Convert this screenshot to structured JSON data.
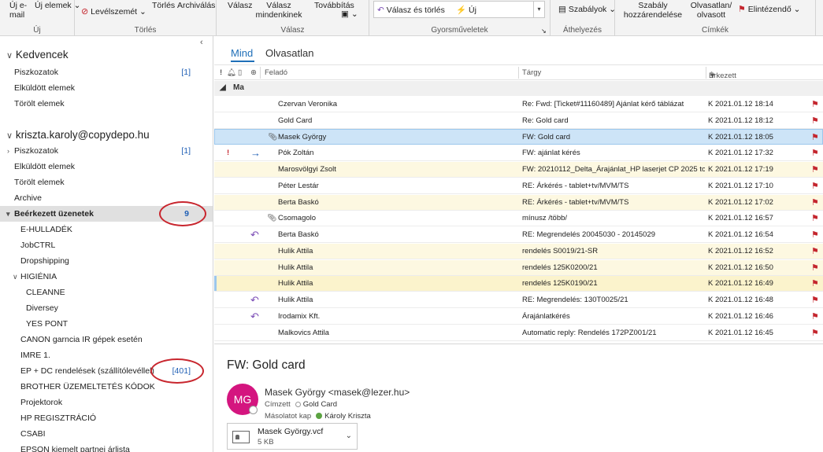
{
  "ribbon": {
    "groups": [
      {
        "caption": "Új"
      },
      {
        "caption": "Törlés"
      },
      {
        "caption": "Válasz"
      },
      {
        "caption": "Gyorsműveletek"
      },
      {
        "caption": "Áthelyezés"
      },
      {
        "caption": "Címkék"
      }
    ],
    "new_email": "Új e-mail",
    "new_items": "Új elemek",
    "junk": "Levélszemét",
    "delete": "Törlés",
    "archive": "Archiválás",
    "reply": "Válasz",
    "reply_all": "Válasz mindenkinek",
    "forward": "Továbbítás",
    "quick_reply_delete": "Válasz és törlés",
    "quick_new": "Új",
    "rules": "Szabályok",
    "assign_policy": "Szabály hozzárendelése",
    "unread_read": "Olvasatlan/ olvasott",
    "followup": "Elintézendő"
  },
  "folders": {
    "favorites_title": "Kedvencek",
    "favorites": [
      {
        "label": "Piszkozatok",
        "count": "[1]"
      },
      {
        "label": "Elküldött elemek",
        "count": ""
      },
      {
        "label": "Törölt elemek",
        "count": ""
      }
    ],
    "account": "kriszta.karoly@copydepo.hu",
    "items": [
      {
        "label": "Piszkozatok",
        "count": "[1]"
      },
      {
        "label": "Elküldött elemek",
        "count": ""
      },
      {
        "label": "Törölt elemek",
        "count": ""
      },
      {
        "label": "Archive",
        "count": ""
      },
      {
        "label": "Beérkezett üzenetek",
        "count": "9"
      },
      {
        "label": "E-HULLADÉK",
        "count": ""
      },
      {
        "label": "JobCTRL",
        "count": ""
      },
      {
        "label": "Dropshipping",
        "count": ""
      },
      {
        "label": "HIGIÉNIA",
        "count": ""
      },
      {
        "label": "CLEANNE",
        "count": ""
      },
      {
        "label": "Diversey",
        "count": ""
      },
      {
        "label": "YES PONT",
        "count": ""
      },
      {
        "label": "CANON garncia IR gépek esetén",
        "count": ""
      },
      {
        "label": "IMRE 1.",
        "count": ""
      },
      {
        "label": "EP + DC rendelések (szállítólevéllel)",
        "count": "[401]"
      },
      {
        "label": "BROTHER ÜZEMELTETÉS KÓDOK",
        "count": ""
      },
      {
        "label": "Projektorok",
        "count": ""
      },
      {
        "label": "HP REGISZTRÁCIÓ",
        "count": ""
      },
      {
        "label": "CSABI",
        "count": ""
      },
      {
        "label": "EPSON kiemelt partnei árlista",
        "count": ""
      }
    ]
  },
  "list": {
    "tabs": [
      "Mind",
      "Olvasatlan"
    ],
    "columns": {
      "from": "Feladó",
      "subject": "Tárgy",
      "received": "Érkezett"
    },
    "group": "Ma",
    "rows": [
      {
        "from": "Czervan Veronika",
        "subject": "Re: Fwd: [Ticket#11160489] Ajánlat kérő táblázat",
        "date": "K 2021.01.12 18:14"
      },
      {
        "from": "Gold Card",
        "subject": "Re: Gold card",
        "date": "K 2021.01.12 18:12"
      },
      {
        "from": "Masek György",
        "subject": "FW: Gold card",
        "date": "K 2021.01.12 18:05"
      },
      {
        "from": "Pók Zoltán",
        "subject": "FW: ajánlat kérés",
        "date": "K 2021.01.12 17:32"
      },
      {
        "from": "Marosvölgyi Zsolt",
        "subject": "FW: 20210112_Delta_Árajánlat_HP laserjet CP 2025 to...",
        "date": "K 2021.01.12 17:19"
      },
      {
        "from": "Péter Lestár",
        "subject": "RE: Árkérés - tablet+tv/MVM/TS",
        "date": "K 2021.01.12 17:10"
      },
      {
        "from": "Berta Baskó",
        "subject": "RE: Árkérés - tablet+tv/MVM/TS",
        "date": "K 2021.01.12 17:02"
      },
      {
        "from": "Csomagolo",
        "subject": "mínusz /több/",
        "date": "K 2021.01.12 16:57"
      },
      {
        "from": "Berta Baskó",
        "subject": "RE: Megrendelés 20045030 - 20145029",
        "date": "K 2021.01.12 16:54"
      },
      {
        "from": "Hulik Attila",
        "subject": "rendelés S0019/21-SR",
        "date": "K 2021.01.12 16:52"
      },
      {
        "from": "Hulik Attila",
        "subject": "rendelés 125K0200/21",
        "date": "K 2021.01.12 16:50"
      },
      {
        "from": "Hulik Attila",
        "subject": "rendelés 125K0190/21",
        "date": "K 2021.01.12 16:49"
      },
      {
        "from": "Hulik Attila",
        "subject": "RE: Megrendelés: 130T0025/21",
        "date": "K 2021.01.12 16:48"
      },
      {
        "from": "Irodamix Kft.",
        "subject": "Árajánlatkérés",
        "date": "K 2021.01.12 16:46"
      },
      {
        "from": "Malkovics Attila",
        "subject": "Automatic reply: Rendelés 172PZ001/21",
        "date": "K 2021.01.12 16:45"
      }
    ]
  },
  "reading": {
    "subject": "FW: Gold card",
    "initials": "MG",
    "from": "Masek György <masek@lezer.hu>",
    "to_label": "Címzett",
    "to": "Gold Card",
    "cc_label": "Másolatot kap",
    "cc": "Károly Kriszta",
    "attachment_name": "Masek György.vcf",
    "attachment_size": "5 KB"
  },
  "colors": {
    "accent": "#1f6fb8",
    "selected_row": "#cde4f7",
    "unread_yellow": "#fdf8e1",
    "highlight": "#c8262e",
    "avatar": "#d4157f"
  }
}
